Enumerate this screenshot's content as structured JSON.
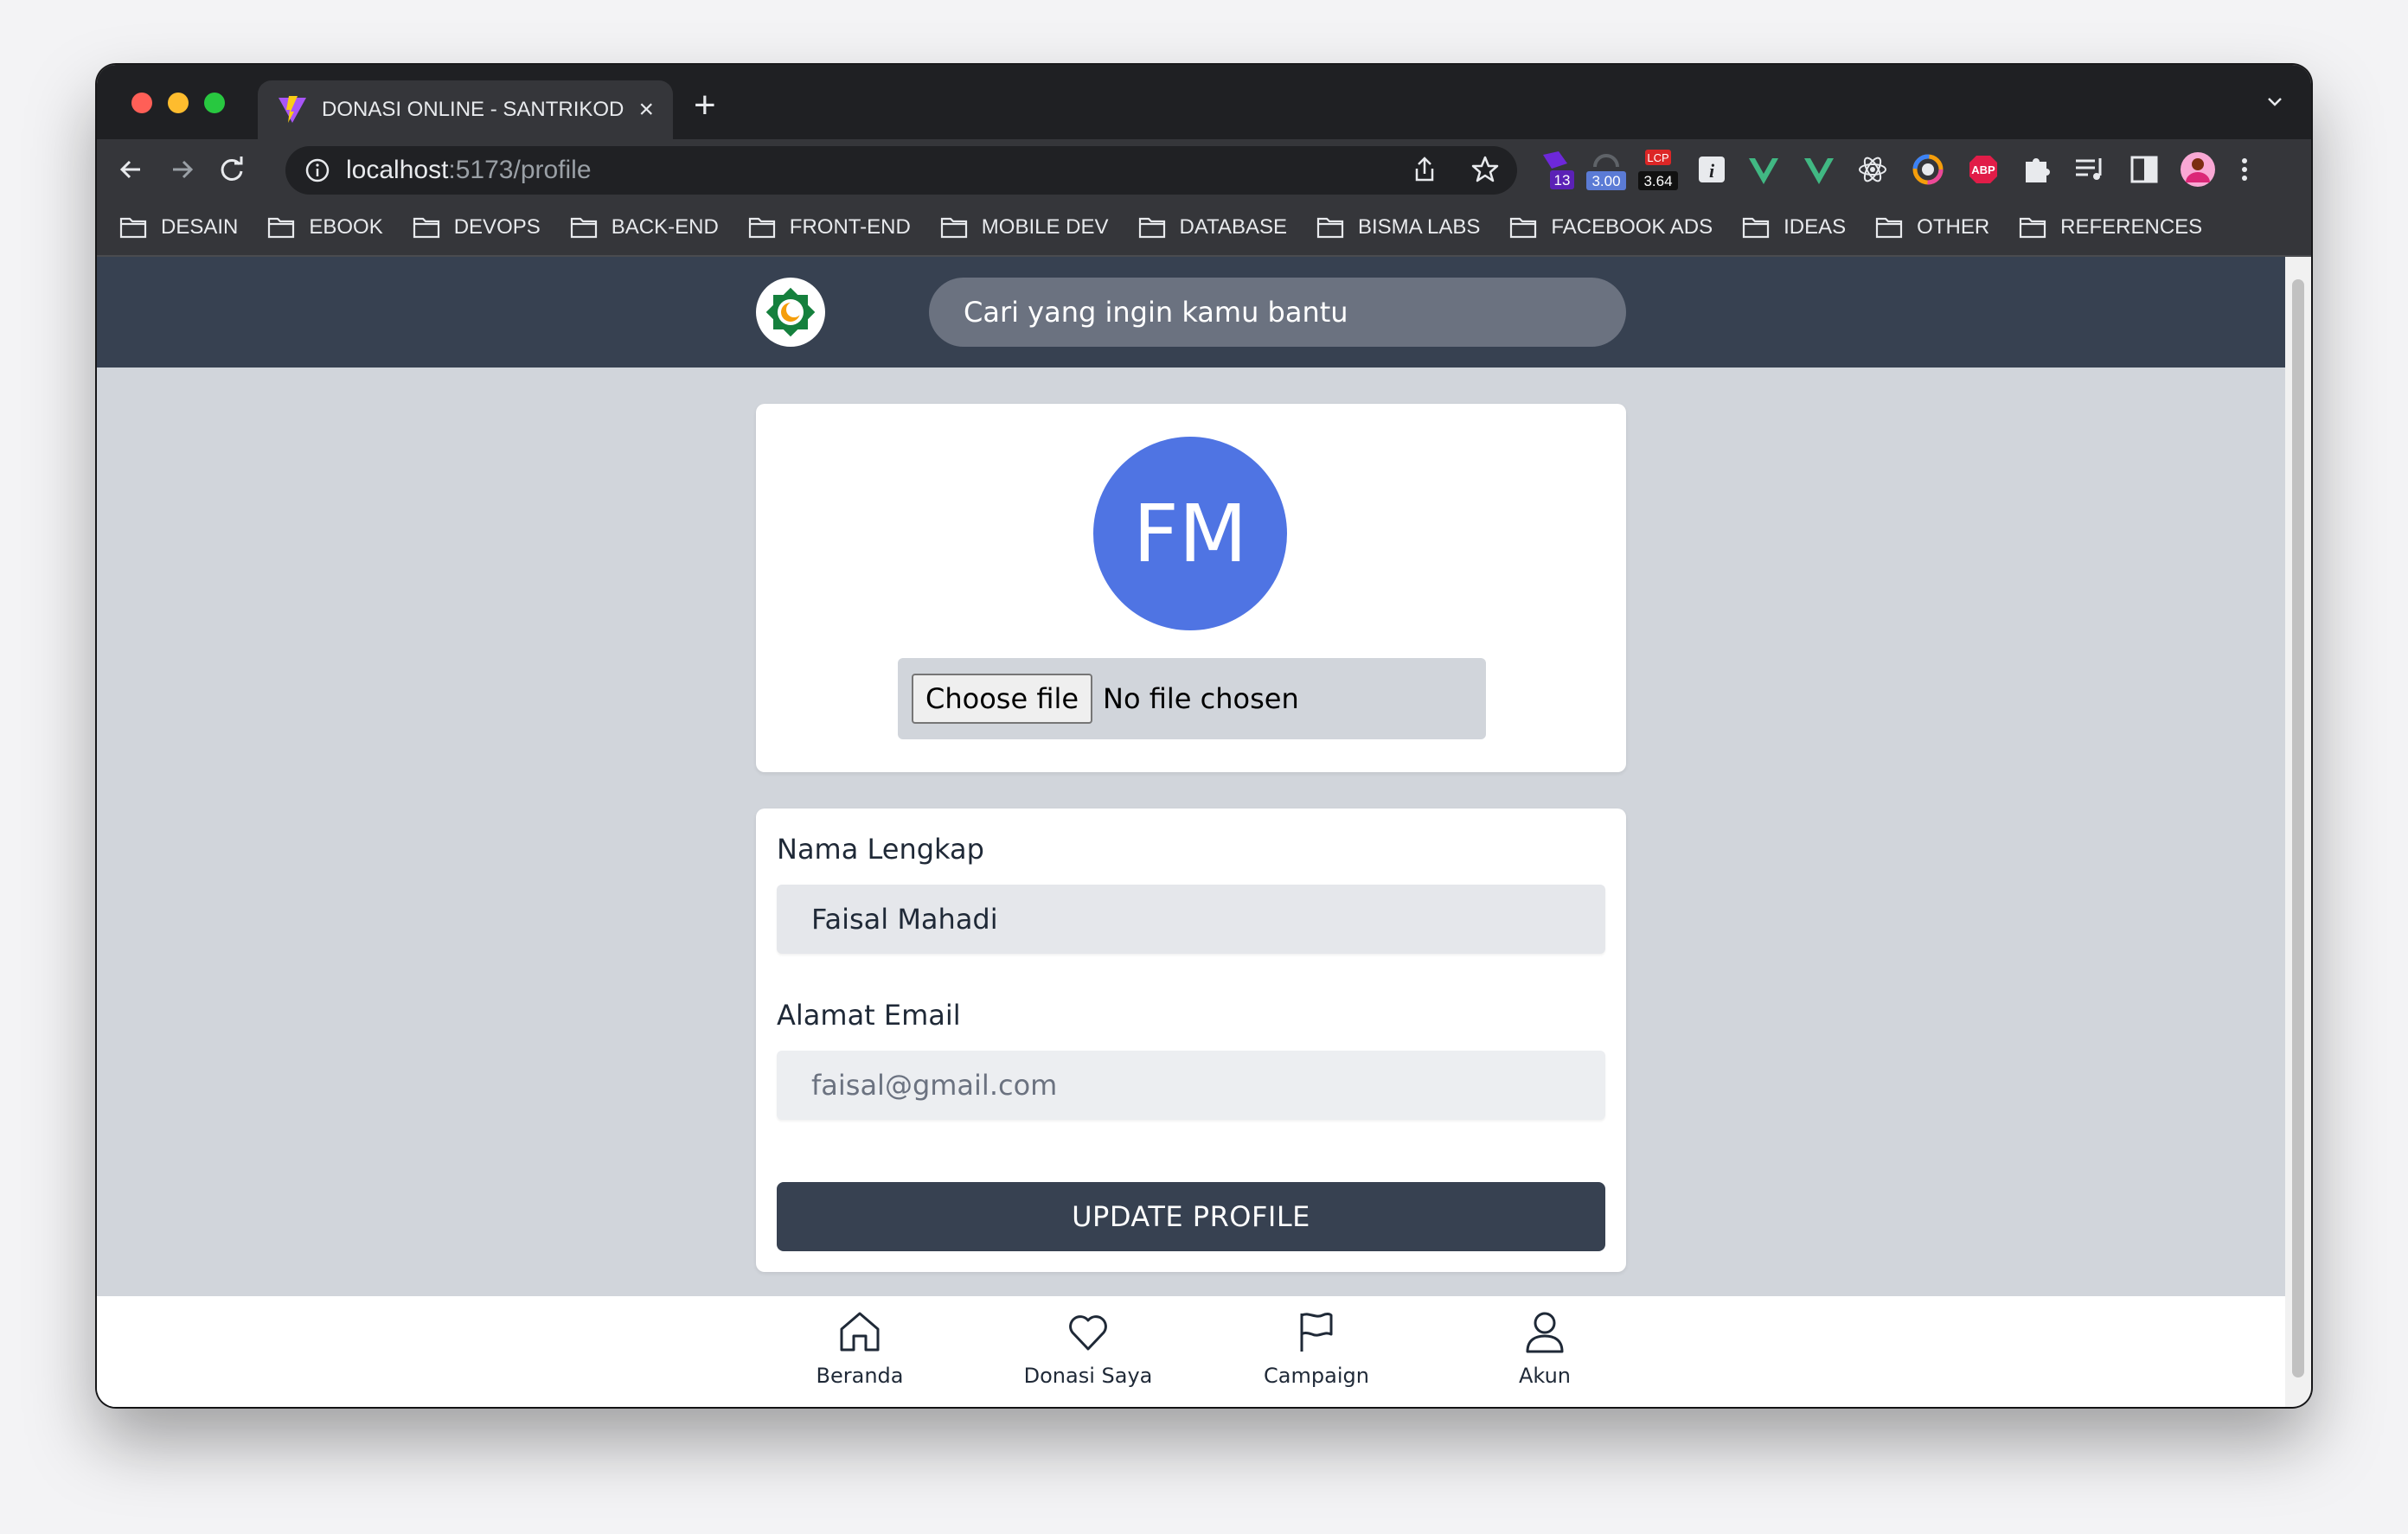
{
  "browser": {
    "tab_title": "DONASI ONLINE - SANTRIKOD",
    "url_host": "localhost",
    "url_path": ":5173/profile",
    "extensions": [
      {
        "name": "extension-a",
        "badge": "13"
      },
      {
        "name": "extension-b",
        "badge": "3.00"
      },
      {
        "name": "lcp-extension",
        "label": "LCP",
        "badge": "3.64"
      },
      {
        "name": "info-extension"
      },
      {
        "name": "vue-devtools-extension"
      },
      {
        "name": "vue-devtools-extension-2"
      },
      {
        "name": "react-devtools-extension"
      },
      {
        "name": "color-extension"
      },
      {
        "name": "adblock-extension",
        "label": "ABP"
      },
      {
        "name": "puzzle-extension"
      },
      {
        "name": "media-extension"
      },
      {
        "name": "sidepanel-extension"
      },
      {
        "name": "profile-avatar"
      },
      {
        "name": "menu-extension"
      }
    ],
    "bookmarks": [
      "DESAIN",
      "EBOOK",
      "DEVOPS",
      "BACK-END",
      "FRONT-END",
      "MOBILE DEV",
      "DATABASE",
      "BISMA LABS",
      "FACEBOOK ADS",
      "IDEAS",
      "OTHER",
      "REFERENCES"
    ]
  },
  "header": {
    "search_placeholder": "Cari yang ingin kamu bantu"
  },
  "profile": {
    "initials": "FM",
    "choose_file_label": "Choose file",
    "no_file_label": "No file chosen",
    "name_label": "Nama Lengkap",
    "name_value": "Faisal Mahadi",
    "email_label": "Alamat Email",
    "email_value": "faisal@gmail.com",
    "update_button": "UPDATE PROFILE"
  },
  "bottom_nav": [
    {
      "label": "Beranda",
      "icon": "home-icon"
    },
    {
      "label": "Donasi Saya",
      "icon": "heart-icon"
    },
    {
      "label": "Campaign",
      "icon": "flag-icon"
    },
    {
      "label": "Akun",
      "icon": "user-icon"
    }
  ],
  "colors": {
    "header_bg": "#374151",
    "page_bg": "#d1d5db",
    "avatar_bg": "#4f74e3",
    "button_bg": "#374151"
  }
}
